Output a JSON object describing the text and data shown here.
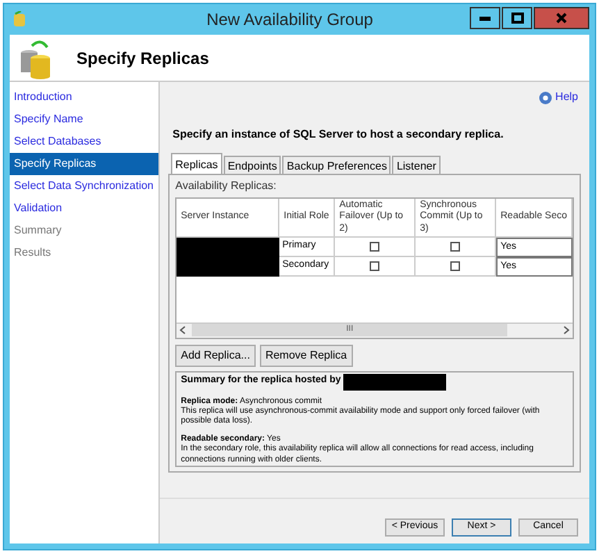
{
  "window": {
    "title": "New Availability Group"
  },
  "header": {
    "title": "Specify Replicas"
  },
  "sidebar": {
    "items": [
      {
        "label": "Introduction",
        "selected": false,
        "disabled": false
      },
      {
        "label": "Specify Name",
        "selected": false,
        "disabled": false
      },
      {
        "label": "Select Databases",
        "selected": false,
        "disabled": false
      },
      {
        "label": "Specify Replicas",
        "selected": true,
        "disabled": false
      },
      {
        "label": "Select Data Synchronization",
        "selected": false,
        "disabled": false
      },
      {
        "label": "Validation",
        "selected": false,
        "disabled": false
      },
      {
        "label": "Summary",
        "selected": false,
        "disabled": true
      },
      {
        "label": "Results",
        "selected": false,
        "disabled": true
      }
    ]
  },
  "help": "Help",
  "instruction": "Specify an instance of SQL Server to host a secondary replica.",
  "tabs": [
    {
      "label": "Replicas",
      "selected": true
    },
    {
      "label": "Endpoints",
      "selected": false
    },
    {
      "label": "Backup Preferences",
      "selected": false
    },
    {
      "label": "Listener",
      "selected": false
    }
  ],
  "group_label": "Availability Replicas:",
  "table": {
    "columns": [
      "Server Instance",
      "Initial Role",
      "Automatic Failover (Up to 2)",
      "Synchronous Commit (Up to 3)",
      "Readable Seco"
    ],
    "rows": [
      {
        "role": "Primary",
        "automatic_failover": false,
        "synchronous_commit": false,
        "readable": "Yes"
      },
      {
        "role": "Secondary",
        "automatic_failover": false,
        "synchronous_commit": false,
        "readable": "Yes"
      }
    ]
  },
  "scroll_thumb": "III",
  "buttons": [
    "Add Replica...",
    "Remove Replica"
  ],
  "summary": {
    "title": "Summary for the replica hosted by",
    "sections": [
      {
        "heading": "**Replica mode:** Asynchronous commit",
        "text": "This replica will use asynchronous-commit availability mode and support only forced failover (with possible data loss)."
      },
      {
        "heading": "**Readable secondary:** Yes",
        "text": "In the secondary role, this availability replica will allow all connections for read access, including connections running with older clients."
      }
    ]
  },
  "footer_buttons": [
    "< Previous",
    "Next >",
    "Cancel"
  ]
}
